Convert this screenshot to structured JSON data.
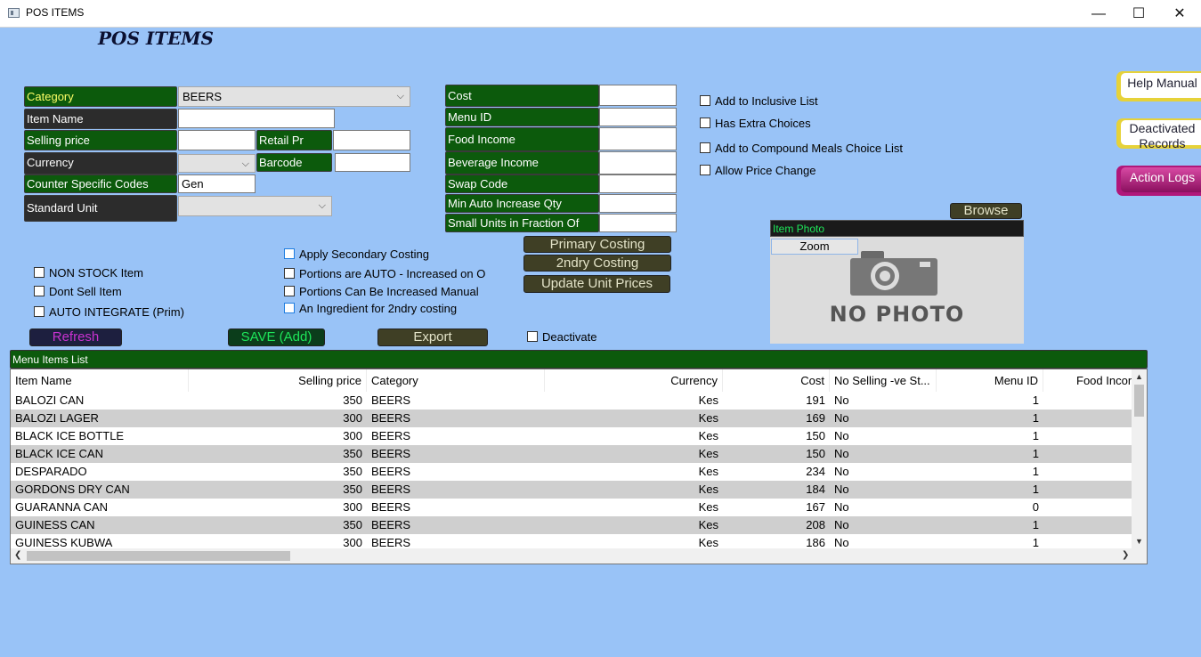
{
  "window": {
    "title": "POS ITEMS",
    "minimize": "—",
    "maximize": "☐",
    "close": "✕"
  },
  "page_title": "POS ITEMS",
  "form": {
    "category_label": "Category",
    "category_value": "BEERS",
    "item_name_label": "Item Name",
    "item_name_value": "",
    "selling_price_label": "Selling price",
    "selling_price_value": "",
    "retail_pr_label": "Retail Pr",
    "retail_pr_value": "",
    "currency_label": "Currency",
    "currency_value": "",
    "barcode_label": "Barcode",
    "barcode_value": "",
    "counter_codes_label": "Counter Specific Codes",
    "counter_codes_value": "Gen",
    "standard_unit_label": "Standard Unit",
    "standard_unit_value": ""
  },
  "costing": {
    "cost_label": "Cost",
    "menu_id_label": "Menu ID",
    "food_income_label": "Food Income",
    "beverage_income_label": "Beverage Income",
    "swap_code_label": "Swap Code",
    "min_auto_label": "Min Auto Increase Qty",
    "small_units_label": "Small Units in Fraction Of"
  },
  "options": {
    "add_inclusive": "Add to Inclusive List",
    "extra_choices": "Has Extra Choices",
    "compound_meals": "Add to Compound Meals Choice List",
    "allow_price_change": "Allow Price Change"
  },
  "flags": {
    "non_stock": "NON STOCK Item",
    "dont_sell": "Dont Sell Item",
    "auto_integrate": "AUTO INTEGRATE (Prim)",
    "apply_secondary": "Apply Secondary Costing",
    "portions_auto": "Portions are AUTO - Increased on Or",
    "portions_manual": "Portions Can Be Increased Manual",
    "ingredient_2ndry": "An Ingredient for 2ndry costing",
    "deactivate": "Deactivate"
  },
  "buttons": {
    "primary_costing": "Primary Costing",
    "secondary_costing": "2ndry Costing",
    "update_prices": "Update Unit Prices",
    "refresh": "Refresh",
    "save": "SAVE (Add)",
    "export": "Export",
    "browse": "Browse"
  },
  "side_buttons": {
    "help": "Help Manual",
    "deactivated": "Deactivated Records",
    "action_logs": "Action Logs"
  },
  "photo": {
    "header": "Item Photo",
    "zoom": "Zoom",
    "placeholder": "NO PHOTO"
  },
  "list": {
    "header": "Menu Items List",
    "columns": [
      "Item Name",
      "Selling price",
      "Category",
      "Currency",
      "Cost",
      "No Selling -ve St...",
      "Menu ID",
      "Food Income"
    ],
    "rows": [
      [
        "BALOZI CAN",
        "350",
        "BEERS",
        "Kes",
        "191",
        "No",
        "1",
        ""
      ],
      [
        "BALOZI LAGER",
        "300",
        "BEERS",
        "Kes",
        "169",
        "No",
        "1",
        ""
      ],
      [
        "BLACK ICE BOTTLE",
        "300",
        "BEERS",
        "Kes",
        "150",
        "No",
        "1",
        ""
      ],
      [
        "BLACK ICE CAN",
        "350",
        "BEERS",
        "Kes",
        "150",
        "No",
        "1",
        ""
      ],
      [
        "DESPARADO",
        "350",
        "BEERS",
        "Kes",
        "234",
        "No",
        "1",
        ""
      ],
      [
        "GORDONS DRY  CAN",
        "350",
        "BEERS",
        "Kes",
        "184",
        "No",
        "1",
        ""
      ],
      [
        "GUARANNA CAN",
        "300",
        "BEERS",
        "Kes",
        "167",
        "No",
        "0",
        ""
      ],
      [
        "GUINESS CAN",
        "350",
        "BEERS",
        "Kes",
        "208",
        "No",
        "1",
        ""
      ],
      [
        "GUINESS KUBWA",
        "300",
        "BEERS",
        "Kes",
        "186",
        "No",
        "1",
        ""
      ]
    ]
  },
  "colors": {
    "background": "#99c3f7",
    "label_green": "#0c5a0c",
    "label_dark": "#2c2c2c",
    "button_olive": "#3f3f25",
    "row_alt": "#cfcfcf"
  }
}
